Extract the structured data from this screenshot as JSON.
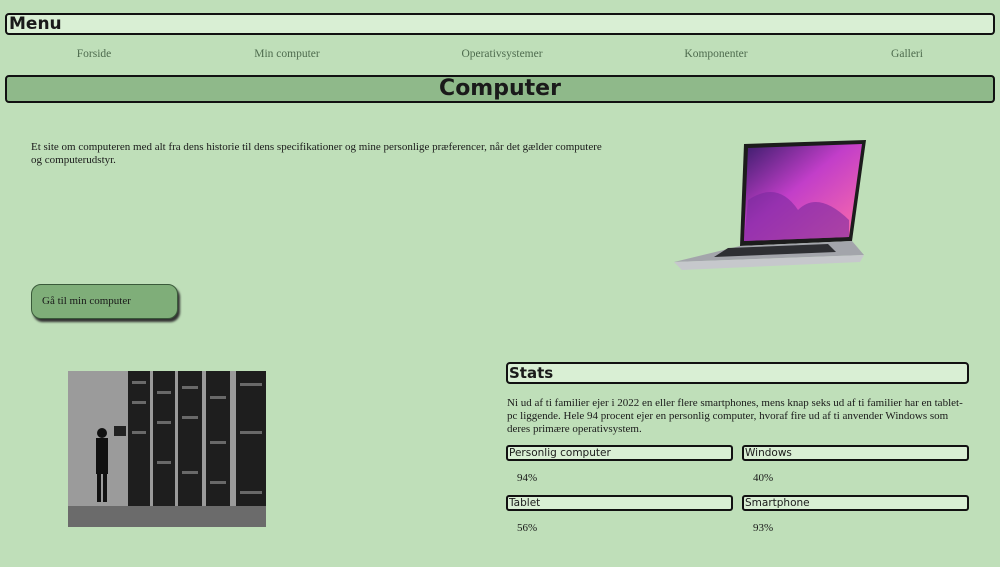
{
  "menu": {
    "title": "Menu"
  },
  "nav": {
    "items": [
      "Forside",
      "Min computer",
      "Operativsystemer",
      "Komponenter",
      "Galleri"
    ]
  },
  "header": {
    "title": "Computer"
  },
  "intro": {
    "text": "Et site om computeren med alt fra dens historie til dens specifikationer og mine personlige præferencer, når det gælder computere og computerudstyr."
  },
  "cta": {
    "label": "Gå til min computer"
  },
  "stats": {
    "title": "Stats",
    "text": "Ni ud af ti familier ejer i 2022 en eller flere smartphones, mens knap seks ud af ti familier har en tablet-pc liggende. Hele 94 procent ejer en personlig computer, hvoraf fire ud af ti anvender Windows som deres primære operativsystem.",
    "items": [
      {
        "label": "Personlig computer",
        "value": "94%"
      },
      {
        "label": "Windows",
        "value": "40%"
      },
      {
        "label": "Tablet",
        "value": "56%"
      },
      {
        "label": "Smartphone",
        "value": "93%"
      }
    ]
  },
  "colors": {
    "background": "#bfdfb9",
    "header": "#8fb98a",
    "box": "#d9efd4",
    "button": "#7fae79"
  }
}
